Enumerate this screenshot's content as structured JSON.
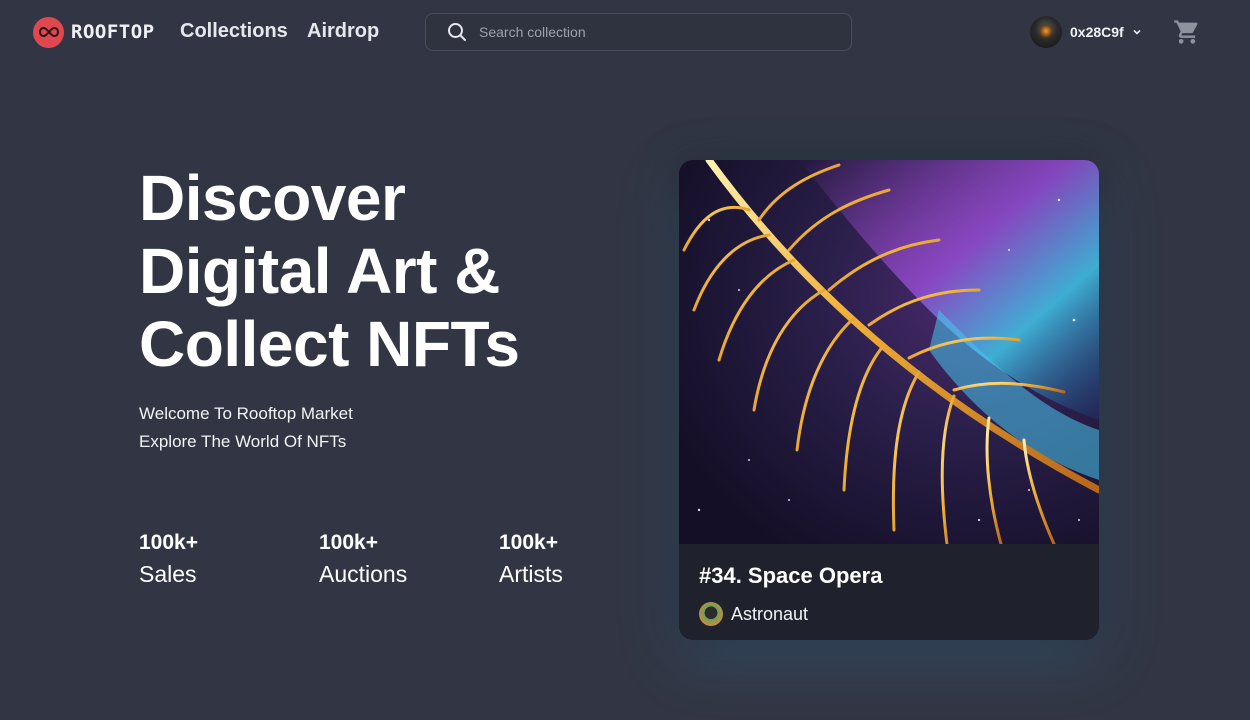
{
  "header": {
    "brand": "ROOFTOP",
    "nav": [
      {
        "label": "Collections"
      },
      {
        "label": "Airdrop"
      }
    ],
    "search": {
      "placeholder": "Search collection",
      "value": ""
    },
    "account": {
      "address": "0x28C9f"
    },
    "icons": {
      "logo": "infinity-logo-icon",
      "search": "search-icon",
      "chevron": "chevron-down-icon",
      "cart": "cart-icon"
    }
  },
  "hero": {
    "title_lines": [
      "Discover",
      "Digital Art &",
      "Collect NFTs"
    ],
    "subtitle_lines": [
      "Welcome To Rooftop Market",
      "Explore The World Of NFTs"
    ],
    "stats": [
      {
        "value": "100k+",
        "label": "Sales"
      },
      {
        "value": "100k+",
        "label": "Auctions"
      },
      {
        "value": "100k+",
        "label": "Artists"
      }
    ]
  },
  "featured": {
    "title": "#34. Space Opera",
    "creator": "Astronaut"
  },
  "colors": {
    "background": "#323644",
    "card": "#1f222c",
    "brand_red": "#e0484f",
    "text": "#ffffff"
  }
}
